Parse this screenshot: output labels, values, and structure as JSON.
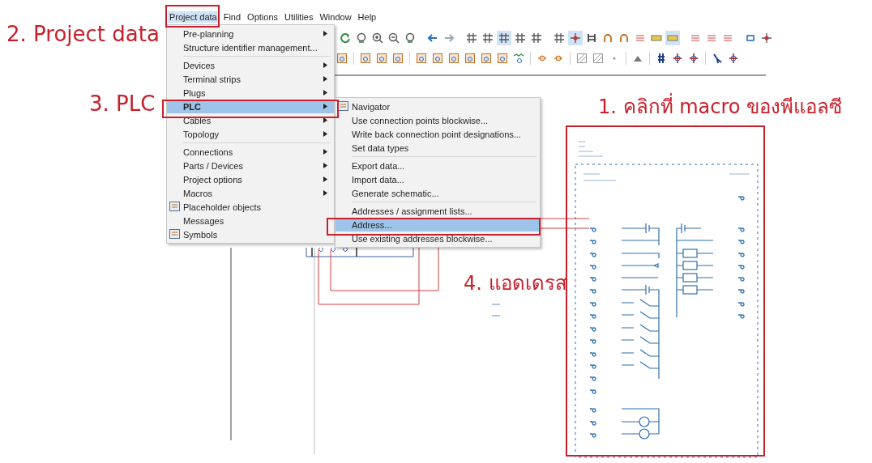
{
  "menu_bar": [
    {
      "label": "Project data",
      "selected": true
    },
    {
      "label": "Find",
      "selected": false
    },
    {
      "label": "Options",
      "selected": false
    },
    {
      "label": "Utilities",
      "selected": false
    },
    {
      "label": "Window",
      "selected": false
    },
    {
      "label": "Help",
      "selected": false
    }
  ],
  "toolbar_rows": [
    [
      {
        "kind": "refresh",
        "selected": false
      },
      {
        "kind": "zoom",
        "selected": false
      },
      {
        "kind": "zoom-in",
        "selected": false
      },
      {
        "kind": "zoom-out",
        "selected": false
      },
      {
        "kind": "zoom",
        "selected": false
      },
      {
        "kind": "separator"
      },
      {
        "kind": "arrow-left",
        "selected": false
      },
      {
        "kind": "arrow-right",
        "selected": false
      },
      {
        "kind": "separator"
      },
      {
        "kind": "hash",
        "selected": false
      },
      {
        "kind": "hash",
        "selected": false
      },
      {
        "kind": "hash",
        "selected": true
      },
      {
        "kind": "hash",
        "selected": false
      },
      {
        "kind": "hash",
        "selected": false
      },
      {
        "kind": "separator"
      },
      {
        "kind": "hash",
        "selected": false
      },
      {
        "kind": "target",
        "selected": true
      },
      {
        "kind": "frame",
        "selected": false
      },
      {
        "kind": "arc",
        "selected": false
      },
      {
        "kind": "arc",
        "selected": false
      },
      {
        "kind": "lines",
        "selected": false
      },
      {
        "kind": "bar",
        "selected": false
      },
      {
        "kind": "bar",
        "selected": true
      },
      {
        "kind": "separator"
      },
      {
        "kind": "lines",
        "selected": false
      },
      {
        "kind": "lines",
        "selected": false
      },
      {
        "kind": "lines",
        "selected": false
      },
      {
        "kind": "separator"
      },
      {
        "kind": "square",
        "selected": false
      },
      {
        "kind": "target",
        "selected": false
      }
    ],
    [
      {
        "kind": "block",
        "selected": false
      },
      {
        "kind": "separator"
      },
      {
        "kind": "block",
        "selected": false
      },
      {
        "kind": "block",
        "selected": false
      },
      {
        "kind": "block",
        "selected": false
      },
      {
        "kind": "separator"
      },
      {
        "kind": "block",
        "selected": false
      },
      {
        "kind": "block",
        "selected": false
      },
      {
        "kind": "block",
        "selected": false
      },
      {
        "kind": "block",
        "selected": false
      },
      {
        "kind": "block",
        "selected": false
      },
      {
        "kind": "block",
        "selected": false
      },
      {
        "kind": "wave",
        "selected": false
      },
      {
        "kind": "separator"
      },
      {
        "kind": "node",
        "selected": false
      },
      {
        "kind": "node",
        "selected": false
      },
      {
        "kind": "separator"
      },
      {
        "kind": "hatch",
        "selected": false
      },
      {
        "kind": "hatch",
        "selected": false
      },
      {
        "kind": "dot",
        "selected": false
      },
      {
        "kind": "separator"
      },
      {
        "kind": "triangle",
        "selected": false
      },
      {
        "kind": "separator"
      },
      {
        "kind": "bus",
        "selected": false
      },
      {
        "kind": "cross",
        "selected": false
      },
      {
        "kind": "cross",
        "selected": false
      },
      {
        "kind": "separator"
      },
      {
        "kind": "kink",
        "selected": false
      },
      {
        "kind": "cross",
        "selected": false
      }
    ]
  ],
  "menu": {
    "items": [
      {
        "label": "Pre-planning",
        "kind": "submenu",
        "selected": false,
        "separator_after": false
      },
      {
        "label": "Structure identifier management...",
        "kind": "plain",
        "selected": false,
        "separator_after": true
      },
      {
        "label": "Devices",
        "kind": "submenu",
        "selected": false,
        "separator_after": false
      },
      {
        "label": "Terminal strips",
        "kind": "submenu",
        "selected": false,
        "separator_after": false
      },
      {
        "label": "Plugs",
        "kind": "submenu",
        "selected": false,
        "separator_after": false
      },
      {
        "label": "PLC",
        "kind": "submenu",
        "selected": true,
        "separator_after": false
      },
      {
        "label": "Cables",
        "kind": "submenu",
        "selected": false,
        "separator_after": false
      },
      {
        "label": "Topology",
        "kind": "submenu",
        "selected": false,
        "separator_after": true
      },
      {
        "label": "Connections",
        "kind": "submenu",
        "selected": false,
        "separator_after": false
      },
      {
        "label": "Parts / Devices",
        "kind": "submenu",
        "selected": false,
        "separator_after": false
      },
      {
        "label": "Project options",
        "kind": "submenu",
        "selected": false,
        "separator_after": false
      },
      {
        "label": "Macros",
        "kind": "submenu",
        "selected": false,
        "separator_after": false
      },
      {
        "label": "Placeholder objects",
        "kind": "with-icon",
        "selected": false,
        "separator_after": false
      },
      {
        "label": "Messages",
        "kind": "plain",
        "selected": false,
        "separator_after": false
      },
      {
        "label": "Symbols",
        "kind": "with-icon",
        "selected": false,
        "separator_after": false
      }
    ]
  },
  "submenu": {
    "items": [
      {
        "label": "Navigator",
        "kind": "with-icon",
        "selected": false,
        "separator_after": false
      },
      {
        "label": "Use connection points blockwise...",
        "kind": "plain",
        "selected": false,
        "separator_after": false
      },
      {
        "label": "Write back connection point designations...",
        "kind": "plain",
        "selected": false,
        "separator_after": false
      },
      {
        "label": "Set data types",
        "kind": "plain",
        "selected": false,
        "separator_after": true
      },
      {
        "label": "Export data...",
        "kind": "plain",
        "selected": false,
        "separator_after": false
      },
      {
        "label": "Import data...",
        "kind": "plain",
        "selected": false,
        "separator_after": false
      },
      {
        "label": "Generate schematic...",
        "kind": "plain",
        "selected": false,
        "separator_after": true
      },
      {
        "label": "Addresses / assignment lists...",
        "kind": "plain",
        "selected": false,
        "separator_after": false
      },
      {
        "label": "Address...",
        "kind": "plain",
        "selected": true,
        "separator_after": false
      },
      {
        "label": "Use existing addresses blockwise...",
        "kind": "plain",
        "selected": false,
        "separator_after": false
      }
    ]
  },
  "annotations": [
    {
      "text": "2. Project data"
    },
    {
      "text": "3. PLC"
    },
    {
      "text": "1. คลิกที่ macro ของพีแอลซี"
    },
    {
      "text": "4. แอดเดรส"
    }
  ]
}
